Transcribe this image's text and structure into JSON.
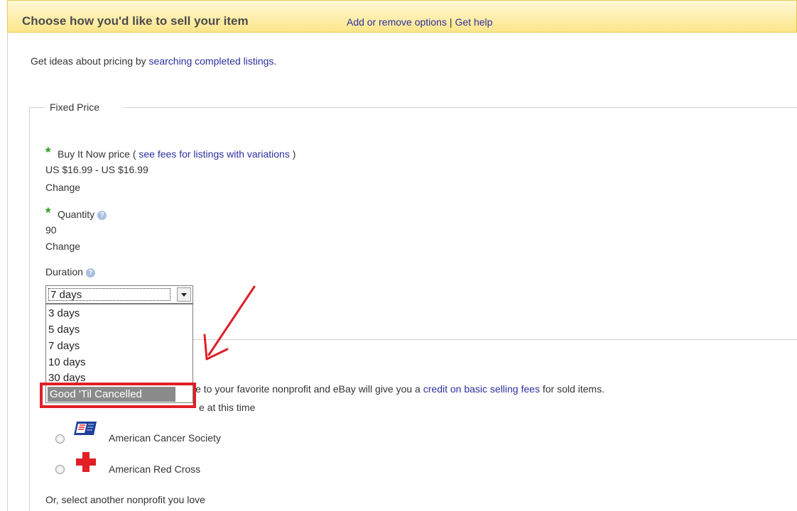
{
  "header": {
    "title": "Choose how you'd like to sell your item",
    "link_add_remove": "Add or remove options",
    "separator": "|",
    "link_help": "Get help"
  },
  "pricing_tip": {
    "prefix": "Get ideas about pricing by ",
    "link": "searching completed listings",
    "suffix": "."
  },
  "fixed_price": {
    "legend": "Fixed Price",
    "buy_it_now": {
      "required_mark": "*",
      "label": "Buy It Now price",
      "open_paren": "(",
      "fees_link": "see fees for listings with variations",
      "close_paren": ")",
      "value": "US $16.99 - US $16.99",
      "change_link": "Change"
    },
    "quantity": {
      "required_mark": "*",
      "label": "Quantity",
      "help_icon": "?",
      "value": "90",
      "change_link": "Change"
    },
    "duration": {
      "label": "Duration",
      "help_icon": "?",
      "selected": "7 days",
      "options": [
        "3 days",
        "5 days",
        "7 days",
        "10 days",
        "30 days"
      ],
      "highlighted_option": "Good 'Til Cancelled"
    }
  },
  "donation": {
    "text_prefix": "le to your favorite nonprofit and eBay will give you a ",
    "credit_link": "credit on basic selling fees",
    "text_suffix": " for sold items.",
    "no_donate_fragment": "e at this time",
    "charities": [
      {
        "name": "American Cancer Society",
        "icon": "american-cancer-society-logo"
      },
      {
        "name": "American Red Cross",
        "icon": "red-cross-icon"
      }
    ],
    "other_link": "Or, select another nonprofit you love"
  },
  "colors": {
    "header_bg": "#fce68a",
    "link": "#2c2f9e",
    "required": "#2a9e1a",
    "highlight": "#e01f26"
  }
}
